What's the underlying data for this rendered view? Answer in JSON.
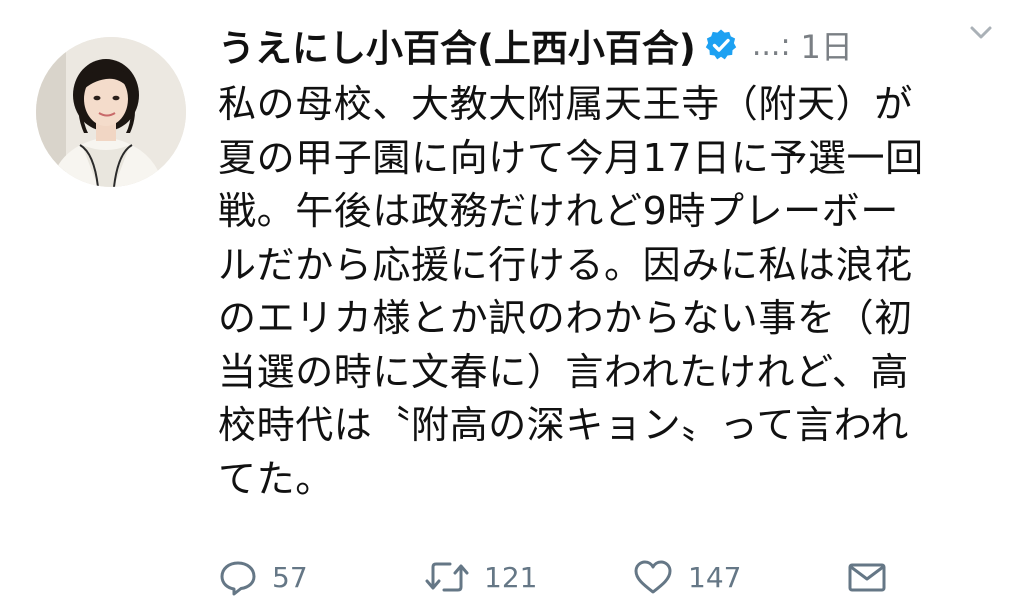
{
  "tweet": {
    "display_name": "うえにし小百合(上西小百合)",
    "handle": "...",
    "separator": ":",
    "time": "1日",
    "body_lines": [
      "私の母校、大教大附属天王寺（附天）が",
      "夏の甲子園に向けて今月17日に予選一回",
      "戦。午後は政務だけれど9時プレーボー",
      "ルだから応援に行ける。因みに私は浪花",
      "のエリカ様とか訳のわからない事を（初",
      "当選の時に文春に）言われたけれど、高",
      "校時代は〝附高の深キョン〟って言われ",
      "てた。"
    ],
    "actions": {
      "reply_count": "57",
      "retweet_count": "121",
      "like_count": "147"
    },
    "icons": {
      "verified": "verified-badge-icon",
      "menu": "chevron-down-icon",
      "reply": "reply-icon",
      "retweet": "retweet-icon",
      "like": "heart-icon",
      "dm": "envelope-icon"
    },
    "colors": {
      "verified": "#1da1f2",
      "muted": "#657786",
      "text": "#111111"
    }
  }
}
